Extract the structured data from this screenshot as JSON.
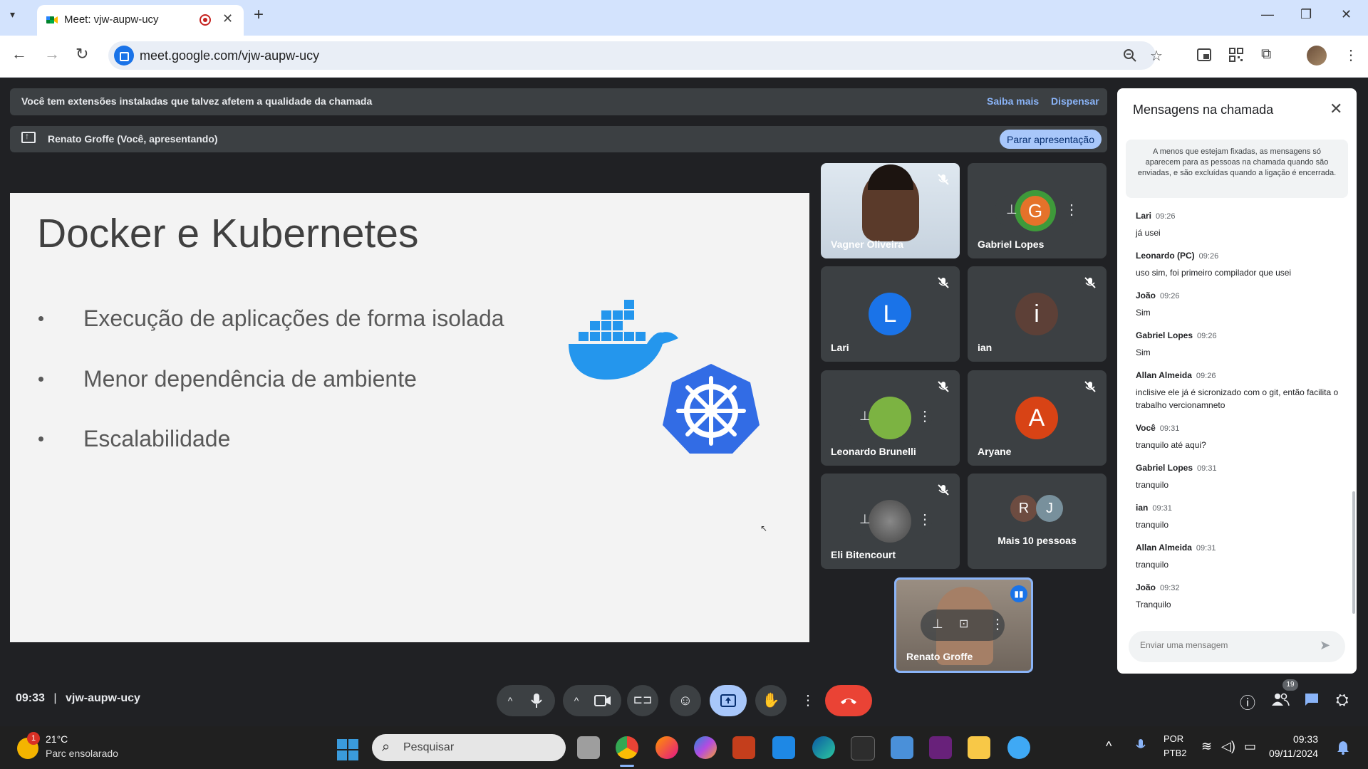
{
  "browser": {
    "tab_title": "Meet: vjw-aupw-ucy",
    "url": "meet.google.com/vjw-aupw-ucy"
  },
  "notice": {
    "text": "Você tem extensões instaladas que talvez afetem a qualidade da chamada",
    "learn_more": "Saiba mais",
    "dismiss": "Dispensar"
  },
  "presenting": {
    "text": "Renato Groffe (Você, apresentando)",
    "stop_label": "Parar apresentação"
  },
  "slide": {
    "title": "Docker e Kubernetes",
    "bullets": [
      "Execução de aplicações de forma isolada",
      "Menor dependência de ambiente",
      "Escalabilidade"
    ]
  },
  "participants": [
    {
      "name": "Vagner Oliveira"
    },
    {
      "name": "Gabriel Lopes"
    },
    {
      "name": "Lari",
      "initial": "L"
    },
    {
      "name": "ian",
      "initial": "i"
    },
    {
      "name": "Leonardo Brunelli"
    },
    {
      "name": "Aryane",
      "initial": "A"
    },
    {
      "name": "Eli Bitencourt"
    },
    {
      "name": "Mais 10 pessoas",
      "initials": [
        "R",
        "J"
      ]
    },
    {
      "name": "Renato Groffe"
    }
  ],
  "meeting": {
    "time": "09:33",
    "code": "vjw-aupw-ucy",
    "people_count": "19"
  },
  "chat": {
    "title": "Mensagens na chamada",
    "note": "A menos que estejam fixadas, as mensagens só aparecem para as pessoas na chamada quando são enviadas, e são excluídas quando a ligação é encerrada.",
    "input_placeholder": "Enviar uma mensagem",
    "messages": [
      {
        "sender": "Lari",
        "time": "09:26",
        "text": "já usei"
      },
      {
        "sender": "Leonardo (PC)",
        "time": "09:26",
        "text": "uso sim, foi primeiro compilador que usei"
      },
      {
        "sender": "João",
        "time": "09:26",
        "text": "Sim"
      },
      {
        "sender": "Gabriel Lopes",
        "time": "09:26",
        "text": "Sim"
      },
      {
        "sender": "Allan Almeida",
        "time": "09:26",
        "text": "inclisive ele já é sicronizado com o git, então facilita o trabalho vercionamneto"
      },
      {
        "sender": "Você",
        "time": "09:31",
        "text": "tranquilo até aqui?"
      },
      {
        "sender": "Gabriel Lopes",
        "time": "09:31",
        "text": "tranquilo"
      },
      {
        "sender": "ian",
        "time": "09:31",
        "text": "tranquilo"
      },
      {
        "sender": "Allan Almeida",
        "time": "09:31",
        "text": "tranquilo"
      },
      {
        "sender": "João",
        "time": "09:32",
        "text": "Tranquilo"
      }
    ]
  },
  "taskbar": {
    "weather_temp": "21°C",
    "weather_desc": "Parc ensolarado",
    "weather_badge": "1",
    "search_placeholder": "Pesquisar",
    "lang_1": "POR",
    "lang_2": "PTB2",
    "time": "09:33",
    "date": "09/11/2024"
  },
  "colors": {
    "meet_bg": "#202124",
    "accent": "#a8c7fa",
    "end_call": "#ea4335",
    "tab_bar": "#d3e3fd"
  }
}
